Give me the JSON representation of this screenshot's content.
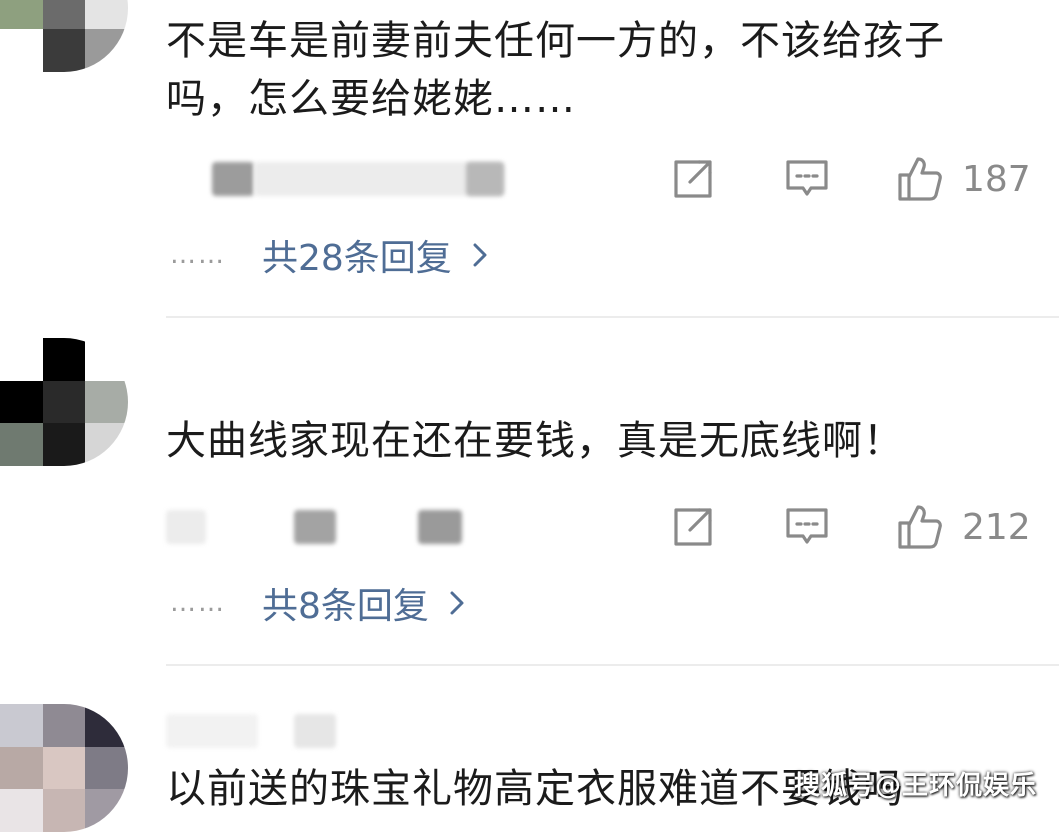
{
  "comments": [
    {
      "text_line1": "不是车是前妻前夫任何一方的，不该给孩子",
      "text_line2": "吗，怎么要给姥姥……",
      "likes": "187",
      "replies_label": "共28条回复",
      "dots": "……"
    },
    {
      "text_line1": "大曲线家现在还在要钱，真是无底线啊！",
      "likes": "212",
      "replies_label": "共8条回复",
      "dots": "……"
    },
    {
      "text_line1": "以前送的珠宝礼物高定衣服难道不要钱吗"
    }
  ],
  "watermark": "搜狐号@王环侃娱乐",
  "icons": {
    "share": "share-icon",
    "comment": "comment-icon",
    "like": "thumbs-up-icon",
    "chevron": "chevron-right-icon"
  },
  "colors": {
    "link": "#4f6d95",
    "icon": "#8a8a8a",
    "text": "#1b1b1b"
  }
}
